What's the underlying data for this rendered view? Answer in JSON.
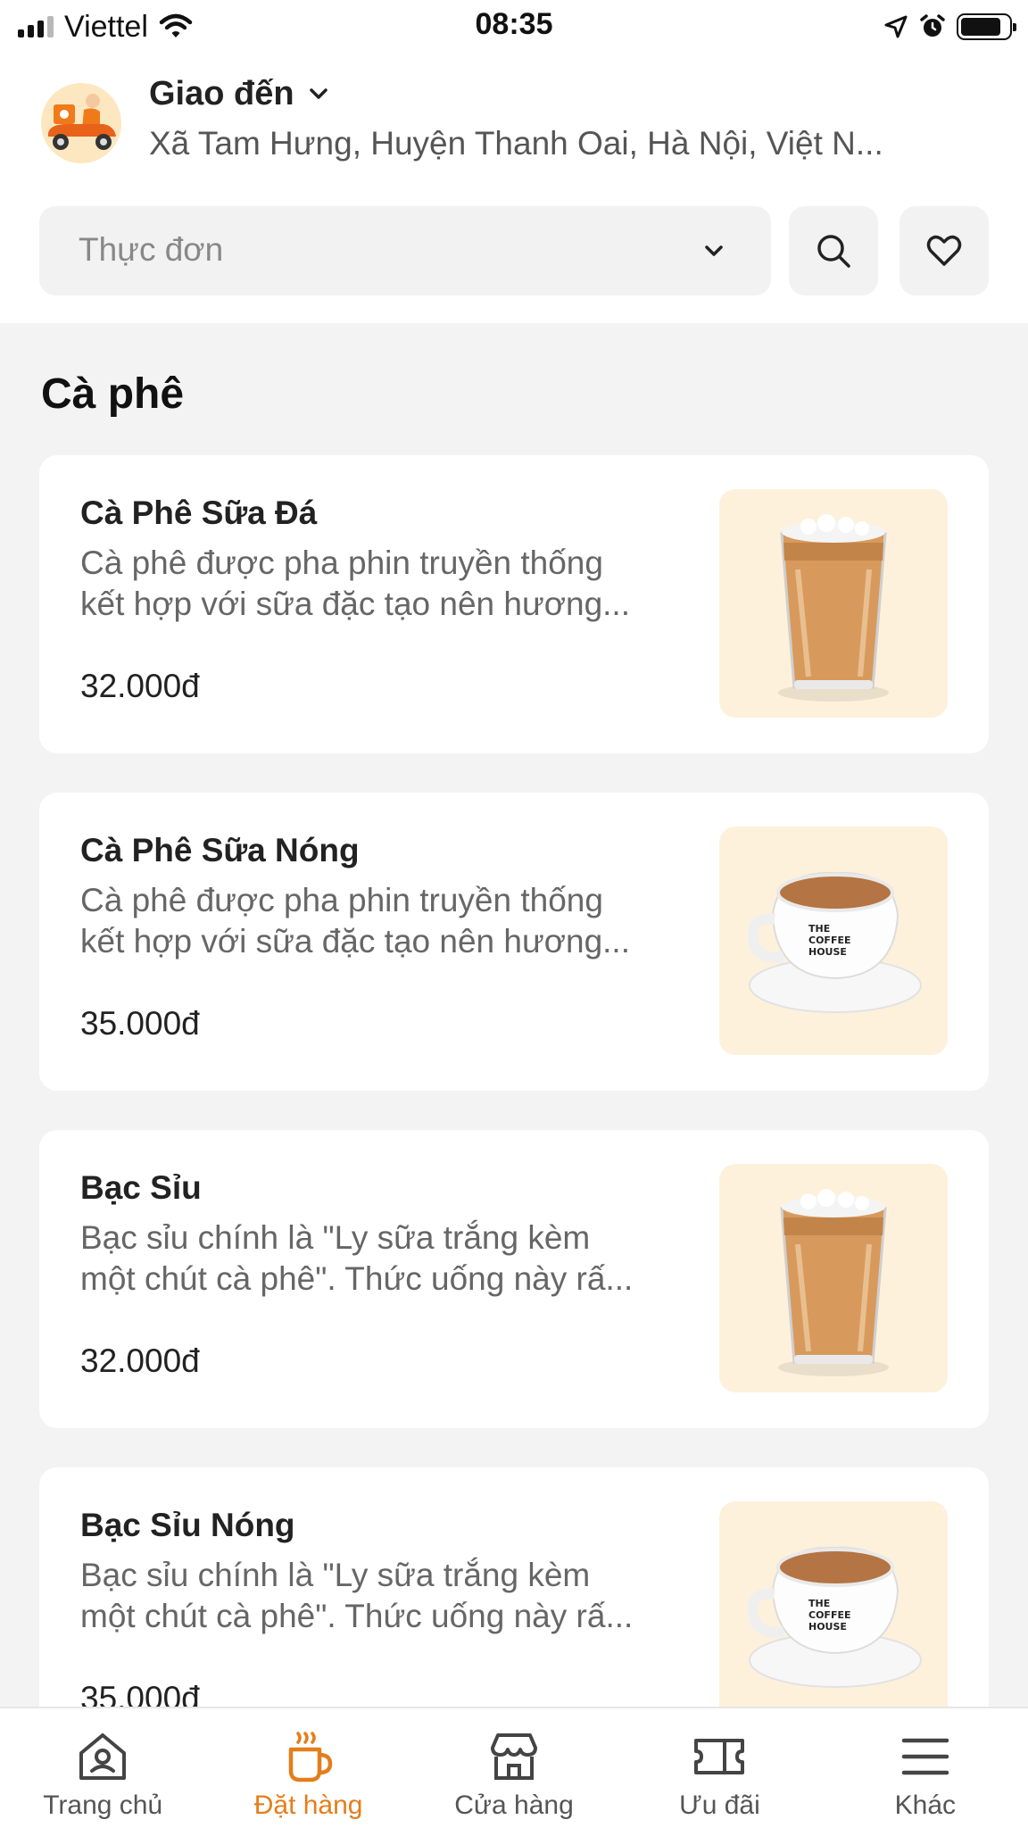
{
  "status_bar": {
    "carrier": "Viettel",
    "time": "08:35",
    "icons": [
      "signal-icon",
      "wifi-icon",
      "location-arrow-icon",
      "alarm-icon",
      "battery-icon"
    ]
  },
  "header": {
    "deliver_label": "Giao đến",
    "address": "Xã Tam Hưng, Huyện Thanh Oai, Hà Nội, Việt N...",
    "menu_select_placeholder": "Thực đơn",
    "accent_color": "#e47e1b"
  },
  "section": {
    "title": "Cà phê"
  },
  "products": [
    {
      "name": "Cà Phê Sữa Đá",
      "description_lines": [
        "Cà phê được pha phin truyền thống",
        "kết hợp với sữa đặc tạo nên hương..."
      ],
      "price": "32.000đ",
      "image": "iced-coffee-glass"
    },
    {
      "name": "Cà Phê Sữa Nóng",
      "description_lines": [
        "Cà phê được pha phin truyền thống",
        "kết hợp với sữa đặc tạo nên hương..."
      ],
      "price": "35.000đ",
      "image": "hot-coffee-cup",
      "cup_text": [
        "THE",
        "COFFEE",
        "HOUSE"
      ]
    },
    {
      "name": "Bạc Sỉu",
      "description_lines": [
        "Bạc sỉu chính là \"Ly sữa trắng kèm",
        "một chút cà phê\". Thức uống này rấ..."
      ],
      "price": "32.000đ",
      "image": "iced-coffee-glass"
    },
    {
      "name": "Bạc Sỉu Nóng",
      "description_lines": [
        "Bạc sỉu chính là \"Ly sữa trắng kèm",
        "một chút cà phê\". Thức uống này rấ..."
      ],
      "price": "35.000đ",
      "image": "hot-coffee-cup",
      "cup_text": [
        "THE",
        "COFFEE",
        "HOUSE"
      ]
    }
  ],
  "bottom_nav": {
    "items": [
      {
        "label": "Trang chủ",
        "icon": "home-icon",
        "active": false
      },
      {
        "label": "Đặt hàng",
        "icon": "coffee-cup-icon",
        "active": true
      },
      {
        "label": "Cửa hàng",
        "icon": "store-icon",
        "active": false
      },
      {
        "label": "Ưu đãi",
        "icon": "ticket-icon",
        "active": false
      },
      {
        "label": "Khác",
        "icon": "menu-icon",
        "active": false
      }
    ]
  }
}
